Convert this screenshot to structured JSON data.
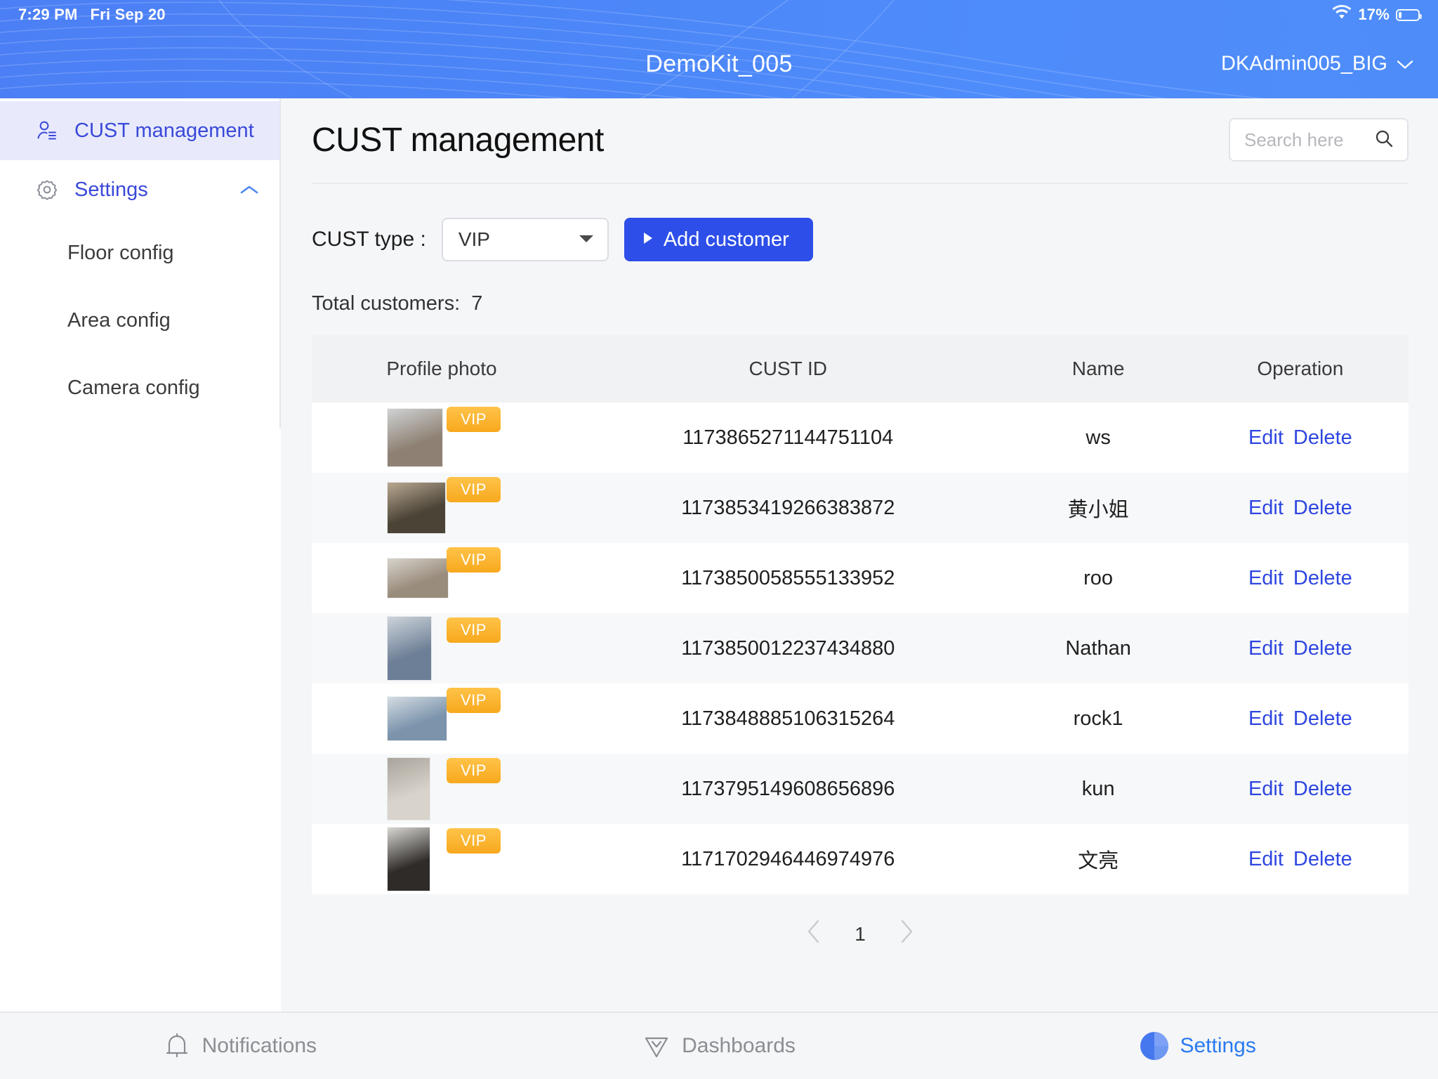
{
  "status_bar": {
    "time": "7:29 PM",
    "date": "Fri Sep 20",
    "wifi_icon": "wifi-icon",
    "battery_percent": "17%",
    "battery_icon": "battery-icon"
  },
  "header": {
    "app_title": "DemoKit_005",
    "user_name": "DKAdmin005_BIG",
    "user_caret_icon": "chevron-down-icon",
    "background_color": "#4b82f6"
  },
  "sidebar": {
    "items": [
      {
        "label": "CUST management",
        "icon": "user-list-icon",
        "active": true
      },
      {
        "label": "Settings",
        "icon": "gear-icon",
        "active": false,
        "expand_icon": "chevron-up-icon"
      }
    ],
    "sub_items": [
      {
        "label": "Floor config"
      },
      {
        "label": "Area config"
      },
      {
        "label": "Camera config"
      }
    ],
    "active_background": "#e8eafc",
    "active_text_color": "#3a49d8"
  },
  "main": {
    "page_title": "CUST management",
    "search": {
      "placeholder": "Search here",
      "value": "",
      "icon": "search-icon"
    },
    "filter": {
      "label": "CUST type :",
      "select_value": "VIP",
      "select_caret_icon": "chevron-down-icon",
      "add_button_label": "Add customer",
      "add_button_icon": "play-triangle-icon",
      "add_button_color": "#2d4ee8"
    },
    "total_label": "Total customers:",
    "total_value": "7",
    "table": {
      "columns": [
        "Profile photo",
        "CUST ID",
        "Name",
        "Operation"
      ],
      "rows": [
        {
          "badge": "VIP",
          "id": "1173865271144751104",
          "name": "ws",
          "edit": "Edit",
          "delete": "Delete"
        },
        {
          "badge": "VIP",
          "id": "1173853419266383872",
          "name": "黄小姐",
          "edit": "Edit",
          "delete": "Delete"
        },
        {
          "badge": "VIP",
          "id": "1173850058555133952",
          "name": "roo",
          "edit": "Edit",
          "delete": "Delete"
        },
        {
          "badge": "VIP",
          "id": "1173850012237434880",
          "name": "Nathan",
          "edit": "Edit",
          "delete": "Delete"
        },
        {
          "badge": "VIP",
          "id": "1173848885106315264",
          "name": "rock1",
          "edit": "Edit",
          "delete": "Delete"
        },
        {
          "badge": "VIP",
          "id": "1173795149608656896",
          "name": "kun",
          "edit": "Edit",
          "delete": "Delete"
        },
        {
          "badge": "VIP",
          "id": "1171702946446974976",
          "name": "文亮",
          "edit": "Edit",
          "delete": "Delete"
        }
      ],
      "badge_color": "#f7a81d"
    },
    "pagination": {
      "prev_icon": "chevron-left-icon",
      "page": "1",
      "next_icon": "chevron-right-icon"
    }
  },
  "tabbar": {
    "tabs": [
      {
        "label": "Notifications",
        "icon": "bell-icon",
        "active": false
      },
      {
        "label": "Dashboards",
        "icon": "shield-chevron-icon",
        "active": false
      },
      {
        "label": "Settings",
        "icon": "pie-circle-icon",
        "active": true
      }
    ],
    "active_color": "#2a7af0"
  }
}
